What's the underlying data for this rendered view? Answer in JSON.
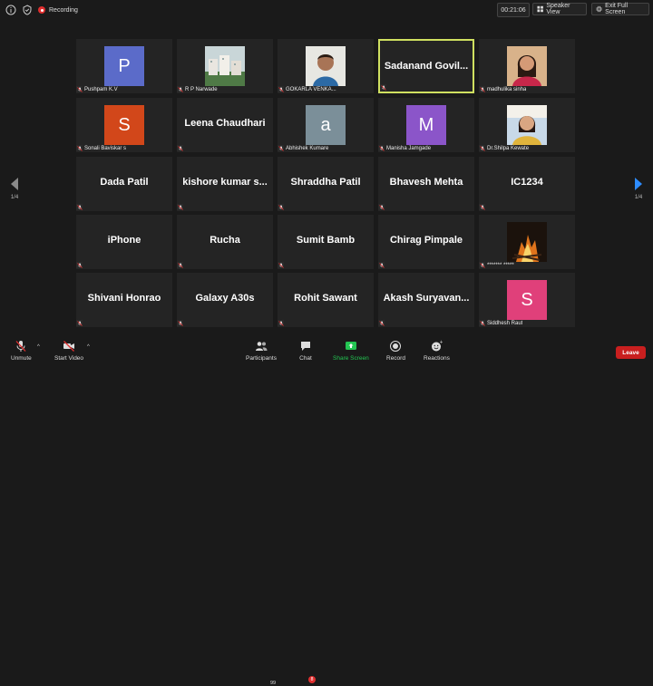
{
  "topbar": {
    "recording_label": "Recording",
    "timer": "00:21:06",
    "speaker_view_label": "Speaker View",
    "exit_fullscreen_label": "Exit Full Screen"
  },
  "pager": {
    "left_label": "1/4",
    "right_label": "1/4"
  },
  "tiles": [
    {
      "name": "Pushpam K.V",
      "type": "avatar",
      "letter": "P",
      "color": "#5b6bc9"
    },
    {
      "name": "R P Narwade",
      "type": "photo",
      "photo": "buildings-photo"
    },
    {
      "name": "GOKARLA VENKA...",
      "type": "photo",
      "photo": "man-photo"
    },
    {
      "name": "",
      "type": "text",
      "display": "Sadanand  Govil...",
      "active": true
    },
    {
      "name": "madhulika sinha",
      "type": "photo",
      "photo": "woman-photo"
    },
    {
      "name": "Sonali Baviskar s",
      "type": "avatar",
      "letter": "S",
      "color": "#d2471a"
    },
    {
      "name": "",
      "type": "text",
      "display": "Leena Chaudhari"
    },
    {
      "name": "Abhishek Kumare",
      "type": "avatar",
      "letter": "a",
      "color": "#7b8f99"
    },
    {
      "name": "Manisha Jamgade",
      "type": "avatar",
      "letter": "M",
      "color": "#8b55c9"
    },
    {
      "name": "Dr.Shilpa Kewate",
      "type": "photo",
      "photo": "woman-photo-2"
    },
    {
      "name": "",
      "type": "text",
      "display": "Dada Patil"
    },
    {
      "name": "",
      "type": "text",
      "display": "kishore kumar s..."
    },
    {
      "name": "",
      "type": "text",
      "display": "Shraddha Patil"
    },
    {
      "name": "",
      "type": "text",
      "display": "Bhavesh Mehta"
    },
    {
      "name": "",
      "type": "text",
      "display": "IC1234"
    },
    {
      "name": "",
      "type": "text",
      "display": "iPhone"
    },
    {
      "name": "",
      "type": "text",
      "display": "Rucha"
    },
    {
      "name": "",
      "type": "text",
      "display": "Sumit Bamb"
    },
    {
      "name": "",
      "type": "text",
      "display": "Chirag Pimpale"
    },
    {
      "name": "******* *****",
      "type": "photo",
      "photo": "fire-photo"
    },
    {
      "name": "",
      "type": "text",
      "display": "Shivani Honrao"
    },
    {
      "name": "",
      "type": "text",
      "display": "Galaxy A30s"
    },
    {
      "name": "",
      "type": "text",
      "display": "Rohit Sawant"
    },
    {
      "name": "",
      "type": "text",
      "display": "Akash  Suryavan..."
    },
    {
      "name": "Siddhesh Raut",
      "type": "avatar",
      "letter": "S",
      "color": "#e0407a"
    }
  ],
  "toolbar": {
    "unmute_label": "Unmute",
    "start_video_label": "Start Video",
    "participants_label": "Participants",
    "participants_count": "99",
    "chat_label": "Chat",
    "chat_badge": "8",
    "share_label": "Share Screen",
    "record_label": "Record",
    "reactions_label": "Reactions",
    "leave_label": "Leave"
  },
  "colors": {
    "active_border": "#cfe060",
    "share_green": "#23c552",
    "leave_red": "#c91f1f",
    "nav_arrow": "#2d8cff"
  }
}
